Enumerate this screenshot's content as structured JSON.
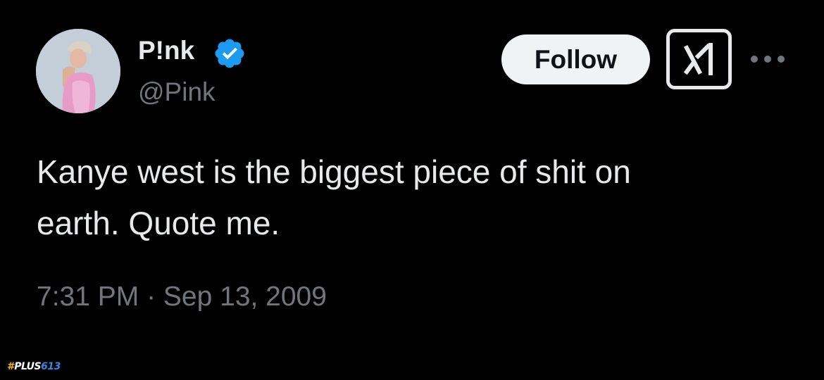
{
  "tweet": {
    "author": {
      "display_name": "P!nk",
      "handle": "@Pink",
      "verified": true,
      "avatar_alt": "avatar"
    },
    "follow_button_label": "Follow",
    "text_lines": [
      "Kanye west is the biggest piece of shit on",
      "earth. Quote me."
    ],
    "timestamp": "7:31 PM · Sep 13, 2009"
  },
  "icons": {
    "verified": "verified-badge-icon",
    "grok": "grok-icon",
    "more": "more-horizontal-icon"
  },
  "watermark": {
    "hash": "#",
    "plus": "PLUS",
    "num": "613"
  },
  "colors": {
    "background": "#000000",
    "text_primary": "#e7e9ea",
    "text_secondary": "#71767b",
    "verified_blue": "#1d9bf0",
    "follow_bg": "#eff3f4",
    "follow_text": "#0f1419"
  }
}
